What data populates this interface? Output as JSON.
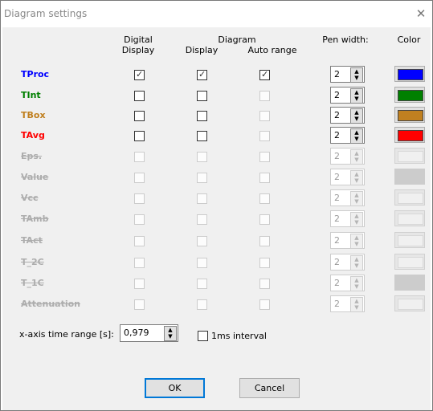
{
  "window": {
    "title": "Diagram settings"
  },
  "headers": {
    "digital_display_1": "Digital",
    "digital_display_2": "Display",
    "diagram": "Diagram",
    "diagram_display": "Display",
    "auto_range": "Auto range",
    "pen_width": "Pen width:",
    "color": "Color"
  },
  "rows": [
    {
      "label": "TProc",
      "label_color": "#0000ff",
      "enabled": true,
      "digital": true,
      "display": true,
      "auto": true,
      "pen": "2",
      "color": "#0000ff"
    },
    {
      "label": "TInt",
      "label_color": "#008000",
      "enabled": true,
      "digital": false,
      "display": false,
      "auto": false,
      "pen": "2",
      "color": "#008000"
    },
    {
      "label": "TBox",
      "label_color": "#c08020",
      "enabled": true,
      "digital": false,
      "display": false,
      "auto": false,
      "pen": "2",
      "color": "#c08020"
    },
    {
      "label": "TAvg",
      "label_color": "#ff0000",
      "enabled": true,
      "digital": false,
      "display": false,
      "auto": false,
      "pen": "2",
      "color": "#ff0000"
    },
    {
      "label": "Eps.",
      "enabled": false,
      "digital": false,
      "display": false,
      "auto": false,
      "pen": "2",
      "color": "#f0f0f0"
    },
    {
      "label": "Value",
      "enabled": false,
      "digital": false,
      "display": false,
      "auto": false,
      "pen": "2",
      "color": "#cccccc"
    },
    {
      "label": "Vcc",
      "enabled": false,
      "digital": false,
      "display": false,
      "auto": false,
      "pen": "2",
      "color": "#f0f0f0"
    },
    {
      "label": "TAmb",
      "enabled": false,
      "digital": false,
      "display": false,
      "auto": false,
      "pen": "2",
      "color": "#f0f0f0"
    },
    {
      "label": "TAct",
      "enabled": false,
      "digital": false,
      "display": false,
      "auto": false,
      "pen": "2",
      "color": "#f0f0f0"
    },
    {
      "label": "T_2C",
      "enabled": false,
      "digital": false,
      "display": false,
      "auto": false,
      "pen": "2",
      "color": "#f0f0f0"
    },
    {
      "label": "T_1C",
      "enabled": false,
      "digital": false,
      "display": false,
      "auto": false,
      "pen": "2",
      "color": "#cccccc"
    },
    {
      "label": "Attenuation",
      "enabled": false,
      "digital": false,
      "display": false,
      "auto": false,
      "pen": "2",
      "color": "#f0f0f0"
    }
  ],
  "time_range": {
    "label": "x-axis time range [s]:",
    "value": "0,979"
  },
  "interval": {
    "label": "1ms interval",
    "checked": false
  },
  "buttons": {
    "ok": "OK",
    "cancel": "Cancel"
  },
  "icons": {
    "close": "close-icon",
    "check": "check-icon",
    "spin_up": "spin-up-icon",
    "spin_down": "spin-down-icon"
  }
}
